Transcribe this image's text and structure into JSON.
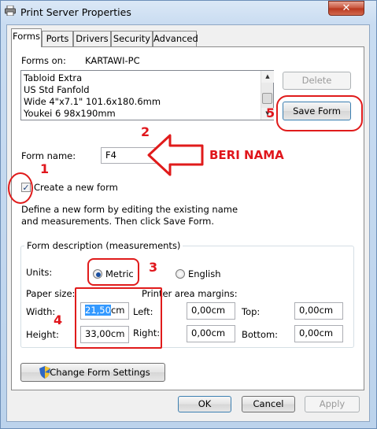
{
  "window": {
    "title": "Print Server Properties",
    "close_label": "✕"
  },
  "tabs": [
    {
      "label": "Forms"
    },
    {
      "label": "Ports"
    },
    {
      "label": "Drivers"
    },
    {
      "label": "Security"
    },
    {
      "label": "Advanced"
    }
  ],
  "forms_on": {
    "label": "Forms on:",
    "server": "KARTAWI-PC"
  },
  "forms_list": [
    "Tabloid Extra",
    "US Std Fanfold",
    "Wide 4\"x7.1\" 101.6x180.6mm",
    "Youkei 6 98x190mm"
  ],
  "buttons": {
    "delete": "Delete",
    "save_form": "Save Form",
    "change_settings": "Change Form Settings",
    "ok": "OK",
    "cancel": "Cancel",
    "apply": "Apply"
  },
  "form_name": {
    "label": "Form name:",
    "value": "F4"
  },
  "create_new": {
    "label": "Create a new form",
    "checked": true
  },
  "description": "Define a new form by editing the existing name and measurements. Then click Save Form.",
  "group": {
    "title": "Form description (measurements)",
    "units_label": "Units:",
    "metric": "Metric",
    "english": "English",
    "paper_size": "Paper size:",
    "margins": "Printer area margins:",
    "width_label": "Width:",
    "width_value": "21,50",
    "width_unit": "cm",
    "height_label": "Height:",
    "height_value": "33,00cm",
    "left_label": "Left:",
    "left_value": "0,00cm",
    "top_label": "Top:",
    "top_value": "0,00cm",
    "right_label": "Right:",
    "right_value": "0,00cm",
    "bottom_label": "Bottom:",
    "bottom_value": "0,00cm"
  },
  "annotations": {
    "n1": "1",
    "n2": "2",
    "n3": "3",
    "n4": "4",
    "n5": "5",
    "beri_nama": "BERI NAMA",
    "color": "#e0161c"
  }
}
